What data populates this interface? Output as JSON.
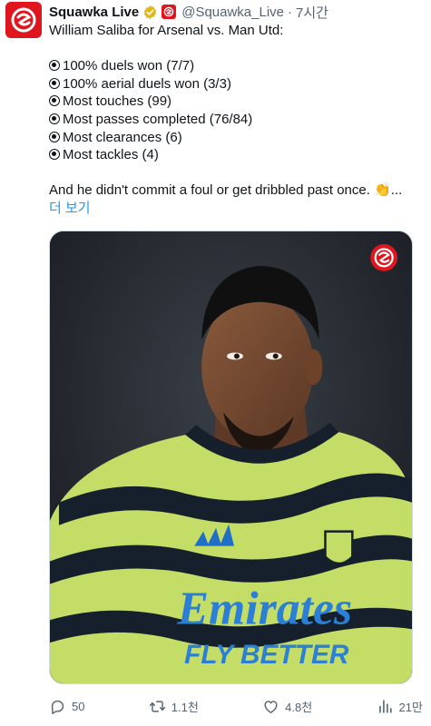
{
  "tweet": {
    "author_name": "Squawka Live",
    "handle": "@Squawka_Live",
    "separator": "·",
    "time": "7시간",
    "intro": "William Saliba for Arsenal vs. Man Utd:",
    "stats": [
      "100% duels won (7/7)",
      "100% aerial duels won (3/3)",
      "Most touches (99)",
      "Most passes completed (76/84)",
      "Most clearances (6)",
      "Most tackles (4)"
    ],
    "closing": "And he didn't commit a foul or get dribbled past once.",
    "closing_emoji": "👏",
    "ellipsis": "...",
    "show_more": "더 보기"
  },
  "media": {
    "shirt_sponsor_line1": "Emirates",
    "shirt_sponsor_line2": "FLY BETTER"
  },
  "actions": {
    "replies": "50",
    "reposts": "1.1천",
    "likes": "4.8천",
    "views": "21만"
  },
  "colors": {
    "brand": "#e0161e",
    "link": "#1d9bf0",
    "muted": "#536471",
    "verified": "#e2b719",
    "kit_green": "#c4dd67",
    "kit_dark": "#16202c"
  }
}
